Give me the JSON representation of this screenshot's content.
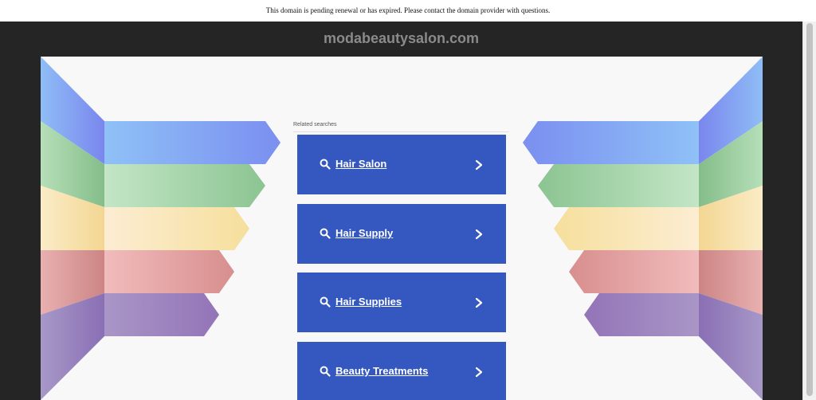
{
  "notice": {
    "text": "This domain is pending renewal or has expired. Please contact the domain provider with questions."
  },
  "header": {
    "domain": "modabeautysalon.com"
  },
  "related": {
    "heading": "Related searches",
    "items": [
      {
        "label": "Hair Salon",
        "icon": "search-icon",
        "action_icon": "chevron-right-icon"
      },
      {
        "label": "Hair Supply",
        "icon": "search-icon",
        "action_icon": "chevron-right-icon"
      },
      {
        "label": "Hair Supplies",
        "icon": "search-icon",
        "action_icon": "chevron-right-icon"
      },
      {
        "label": "Beauty Treatments",
        "icon": "search-icon",
        "action_icon": "chevron-right-icon"
      }
    ]
  },
  "colors": {
    "frame": "#252525",
    "stage": "#f8f8f8",
    "link_background": "#3457c0",
    "link_text": "#ffffff",
    "stripes": [
      "#7b96f2",
      "#8cc492",
      "#f7dfa0",
      "#d98e8e",
      "#9576b8"
    ]
  }
}
